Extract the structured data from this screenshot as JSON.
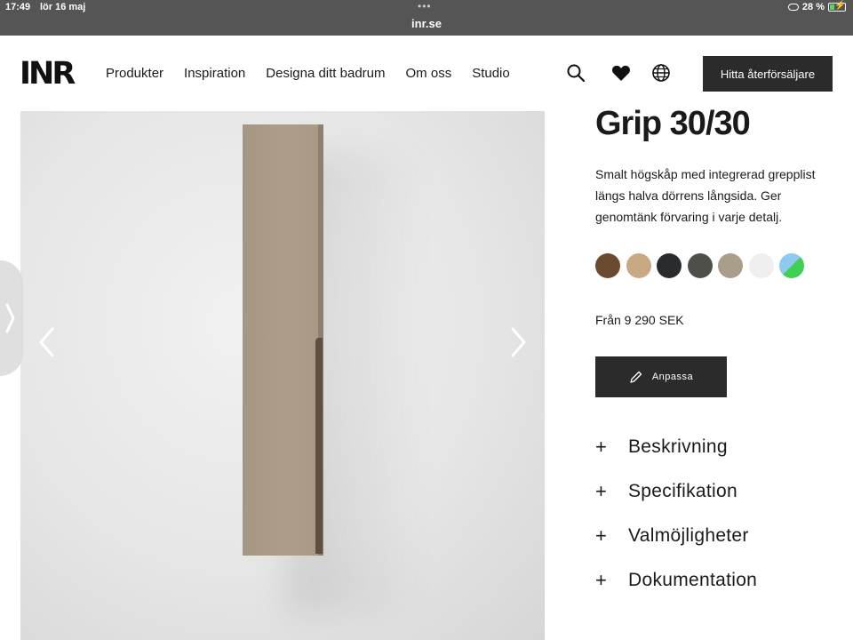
{
  "status_bar": {
    "time": "17:49",
    "date": "lör 16 maj",
    "url": "inr.se",
    "battery": "28 %",
    "battery_level": 0.28
  },
  "header": {
    "logo": "INR",
    "nav": [
      "Produkter",
      "Inspiration",
      "Designa ditt badrum",
      "Om oss",
      "Studio"
    ],
    "icons": [
      "search-icon",
      "heart-icon",
      "globe-icon"
    ],
    "dealer_button": "Hitta återförsäljare"
  },
  "product": {
    "title": "Grip 30/30",
    "description": "Smalt högskåp med integrerad grepplist längs halva dörrens långsida. Ger genomtänk förvaring i varje detalj.",
    "swatches": [
      "#6b4a2f",
      "#c9a884",
      "#2a2b2d",
      "#4f4f49",
      "#a89e8a",
      "#efefef",
      "gradient-blue-green"
    ],
    "price": "Från 9 290 SEK",
    "customize_button": "Anpassa",
    "accordion": [
      "Beskrivning",
      "Specifikation",
      "Valmöjligheter",
      "Dokumentation"
    ]
  },
  "colors": {
    "dark": "#2b2b2b",
    "status_bar": "#555555",
    "cabinet": "#a89986"
  }
}
